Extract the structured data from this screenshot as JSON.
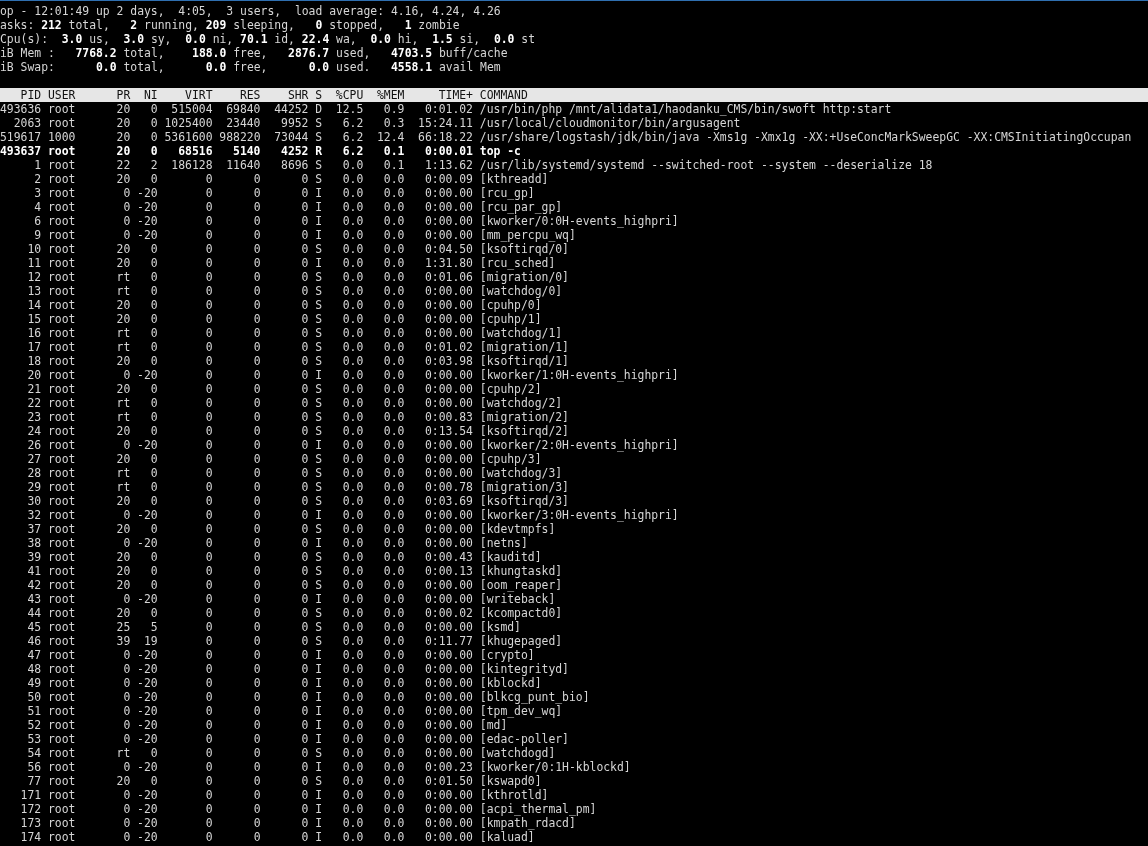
{
  "summary": [
    "op - 12:01:49 up 2 days,  4:05,  3 users,  load average: 4.16, 4.24, 4.26",
    "asks: **212** total,   **2** running, **209** sleeping,   **0** stopped,   **1** zombie",
    "Cpu(s):  **3.0** us,  **3.0** sy,  **0.0** ni, **70.1** id, **22.4** wa,  **0.0** hi,  **1.5** si,  **0.0** st",
    "iB Mem :   **7768.2** total,    **188.0** free,   **2876.7** used,   **4703.5** buff/cache",
    "iB Swap:      **0.0** total,      **0.0** free,      **0.0** used.   **4558.1** avail Mem"
  ],
  "columns": [
    "PID",
    "USER",
    "PR",
    "NI",
    "VIRT",
    "RES",
    "SHR",
    "S",
    "%CPU",
    "%MEM",
    "TIME+",
    "COMMAND"
  ],
  "rows": [
    {
      "bold": false,
      "cells": [
        "493636",
        "root",
        "20",
        "0",
        "515004",
        "69840",
        "44252",
        "D",
        "12.5",
        "0.9",
        "0:01.02",
        "/usr/bin/php /mnt/alidata1/haodanku_CMS/bin/swoft http:start"
      ]
    },
    {
      "bold": false,
      "cells": [
        "2063",
        "root",
        "20",
        "0",
        "1025400",
        "23440",
        "9952",
        "S",
        "6.2",
        "0.3",
        "15:24.11",
        "/usr/local/cloudmonitor/bin/argusagent"
      ]
    },
    {
      "bold": false,
      "cells": [
        "519617",
        "1000",
        "20",
        "0",
        "5361600",
        "988220",
        "73044",
        "S",
        "6.2",
        "12.4",
        "66:18.22",
        "/usr/share/logstash/jdk/bin/java -Xms1g -Xmx1g -XX:+UseConcMarkSweepGC -XX:CMSInitiatingOccupan"
      ]
    },
    {
      "bold": true,
      "cells": [
        "493637",
        "root",
        "20",
        "0",
        "68516",
        "5140",
        "4252",
        "R",
        "6.2",
        "0.1",
        "0:00.01",
        "top -c"
      ]
    },
    {
      "bold": false,
      "cells": [
        "1",
        "root",
        "22",
        "2",
        "186128",
        "11640",
        "8696",
        "S",
        "0.0",
        "0.1",
        "1:13.62",
        "/usr/lib/systemd/systemd --switched-root --system --deserialize 18"
      ]
    },
    {
      "bold": false,
      "cells": [
        "2",
        "root",
        "20",
        "0",
        "0",
        "0",
        "0",
        "S",
        "0.0",
        "0.0",
        "0:00.09",
        "[kthreadd]"
      ]
    },
    {
      "bold": false,
      "cells": [
        "3",
        "root",
        "0",
        "-20",
        "0",
        "0",
        "0",
        "I",
        "0.0",
        "0.0",
        "0:00.00",
        "[rcu_gp]"
      ]
    },
    {
      "bold": false,
      "cells": [
        "4",
        "root",
        "0",
        "-20",
        "0",
        "0",
        "0",
        "I",
        "0.0",
        "0.0",
        "0:00.00",
        "[rcu_par_gp]"
      ]
    },
    {
      "bold": false,
      "cells": [
        "6",
        "root",
        "0",
        "-20",
        "0",
        "0",
        "0",
        "I",
        "0.0",
        "0.0",
        "0:00.00",
        "[kworker/0:0H-events_highpri]"
      ]
    },
    {
      "bold": false,
      "cells": [
        "9",
        "root",
        "0",
        "-20",
        "0",
        "0",
        "0",
        "I",
        "0.0",
        "0.0",
        "0:00.00",
        "[mm_percpu_wq]"
      ]
    },
    {
      "bold": false,
      "cells": [
        "10",
        "root",
        "20",
        "0",
        "0",
        "0",
        "0",
        "S",
        "0.0",
        "0.0",
        "0:04.50",
        "[ksoftirqd/0]"
      ]
    },
    {
      "bold": false,
      "cells": [
        "11",
        "root",
        "20",
        "0",
        "0",
        "0",
        "0",
        "I",
        "0.0",
        "0.0",
        "1:31.80",
        "[rcu_sched]"
      ]
    },
    {
      "bold": false,
      "cells": [
        "12",
        "root",
        "rt",
        "0",
        "0",
        "0",
        "0",
        "S",
        "0.0",
        "0.0",
        "0:01.06",
        "[migration/0]"
      ]
    },
    {
      "bold": false,
      "cells": [
        "13",
        "root",
        "rt",
        "0",
        "0",
        "0",
        "0",
        "S",
        "0.0",
        "0.0",
        "0:00.00",
        "[watchdog/0]"
      ]
    },
    {
      "bold": false,
      "cells": [
        "14",
        "root",
        "20",
        "0",
        "0",
        "0",
        "0",
        "S",
        "0.0",
        "0.0",
        "0:00.00",
        "[cpuhp/0]"
      ]
    },
    {
      "bold": false,
      "cells": [
        "15",
        "root",
        "20",
        "0",
        "0",
        "0",
        "0",
        "S",
        "0.0",
        "0.0",
        "0:00.00",
        "[cpuhp/1]"
      ]
    },
    {
      "bold": false,
      "cells": [
        "16",
        "root",
        "rt",
        "0",
        "0",
        "0",
        "0",
        "S",
        "0.0",
        "0.0",
        "0:00.00",
        "[watchdog/1]"
      ]
    },
    {
      "bold": false,
      "cells": [
        "17",
        "root",
        "rt",
        "0",
        "0",
        "0",
        "0",
        "S",
        "0.0",
        "0.0",
        "0:01.02",
        "[migration/1]"
      ]
    },
    {
      "bold": false,
      "cells": [
        "18",
        "root",
        "20",
        "0",
        "0",
        "0",
        "0",
        "S",
        "0.0",
        "0.0",
        "0:03.98",
        "[ksoftirqd/1]"
      ]
    },
    {
      "bold": false,
      "cells": [
        "20",
        "root",
        "0",
        "-20",
        "0",
        "0",
        "0",
        "I",
        "0.0",
        "0.0",
        "0:00.00",
        "[kworker/1:0H-events_highpri]"
      ]
    },
    {
      "bold": false,
      "cells": [
        "21",
        "root",
        "20",
        "0",
        "0",
        "0",
        "0",
        "S",
        "0.0",
        "0.0",
        "0:00.00",
        "[cpuhp/2]"
      ]
    },
    {
      "bold": false,
      "cells": [
        "22",
        "root",
        "rt",
        "0",
        "0",
        "0",
        "0",
        "S",
        "0.0",
        "0.0",
        "0:00.00",
        "[watchdog/2]"
      ]
    },
    {
      "bold": false,
      "cells": [
        "23",
        "root",
        "rt",
        "0",
        "0",
        "0",
        "0",
        "S",
        "0.0",
        "0.0",
        "0:00.83",
        "[migration/2]"
      ]
    },
    {
      "bold": false,
      "cells": [
        "24",
        "root",
        "20",
        "0",
        "0",
        "0",
        "0",
        "S",
        "0.0",
        "0.0",
        "0:13.54",
        "[ksoftirqd/2]"
      ]
    },
    {
      "bold": false,
      "cells": [
        "26",
        "root",
        "0",
        "-20",
        "0",
        "0",
        "0",
        "I",
        "0.0",
        "0.0",
        "0:00.00",
        "[kworker/2:0H-events_highpri]"
      ]
    },
    {
      "bold": false,
      "cells": [
        "27",
        "root",
        "20",
        "0",
        "0",
        "0",
        "0",
        "S",
        "0.0",
        "0.0",
        "0:00.00",
        "[cpuhp/3]"
      ]
    },
    {
      "bold": false,
      "cells": [
        "28",
        "root",
        "rt",
        "0",
        "0",
        "0",
        "0",
        "S",
        "0.0",
        "0.0",
        "0:00.00",
        "[watchdog/3]"
      ]
    },
    {
      "bold": false,
      "cells": [
        "29",
        "root",
        "rt",
        "0",
        "0",
        "0",
        "0",
        "S",
        "0.0",
        "0.0",
        "0:00.78",
        "[migration/3]"
      ]
    },
    {
      "bold": false,
      "cells": [
        "30",
        "root",
        "20",
        "0",
        "0",
        "0",
        "0",
        "S",
        "0.0",
        "0.0",
        "0:03.69",
        "[ksoftirqd/3]"
      ]
    },
    {
      "bold": false,
      "cells": [
        "32",
        "root",
        "0",
        "-20",
        "0",
        "0",
        "0",
        "I",
        "0.0",
        "0.0",
        "0:00.00",
        "[kworker/3:0H-events_highpri]"
      ]
    },
    {
      "bold": false,
      "cells": [
        "37",
        "root",
        "20",
        "0",
        "0",
        "0",
        "0",
        "S",
        "0.0",
        "0.0",
        "0:00.00",
        "[kdevtmpfs]"
      ]
    },
    {
      "bold": false,
      "cells": [
        "38",
        "root",
        "0",
        "-20",
        "0",
        "0",
        "0",
        "I",
        "0.0",
        "0.0",
        "0:00.00",
        "[netns]"
      ]
    },
    {
      "bold": false,
      "cells": [
        "39",
        "root",
        "20",
        "0",
        "0",
        "0",
        "0",
        "S",
        "0.0",
        "0.0",
        "0:00.43",
        "[kauditd]"
      ]
    },
    {
      "bold": false,
      "cells": [
        "41",
        "root",
        "20",
        "0",
        "0",
        "0",
        "0",
        "S",
        "0.0",
        "0.0",
        "0:00.13",
        "[khungtaskd]"
      ]
    },
    {
      "bold": false,
      "cells": [
        "42",
        "root",
        "20",
        "0",
        "0",
        "0",
        "0",
        "S",
        "0.0",
        "0.0",
        "0:00.00",
        "[oom_reaper]"
      ]
    },
    {
      "bold": false,
      "cells": [
        "43",
        "root",
        "0",
        "-20",
        "0",
        "0",
        "0",
        "I",
        "0.0",
        "0.0",
        "0:00.00",
        "[writeback]"
      ]
    },
    {
      "bold": false,
      "cells": [
        "44",
        "root",
        "20",
        "0",
        "0",
        "0",
        "0",
        "S",
        "0.0",
        "0.0",
        "0:00.02",
        "[kcompactd0]"
      ]
    },
    {
      "bold": false,
      "cells": [
        "45",
        "root",
        "25",
        "5",
        "0",
        "0",
        "0",
        "S",
        "0.0",
        "0.0",
        "0:00.00",
        "[ksmd]"
      ]
    },
    {
      "bold": false,
      "cells": [
        "46",
        "root",
        "39",
        "19",
        "0",
        "0",
        "0",
        "S",
        "0.0",
        "0.0",
        "0:11.77",
        "[khugepaged]"
      ]
    },
    {
      "bold": false,
      "cells": [
        "47",
        "root",
        "0",
        "-20",
        "0",
        "0",
        "0",
        "I",
        "0.0",
        "0.0",
        "0:00.00",
        "[crypto]"
      ]
    },
    {
      "bold": false,
      "cells": [
        "48",
        "root",
        "0",
        "-20",
        "0",
        "0",
        "0",
        "I",
        "0.0",
        "0.0",
        "0:00.00",
        "[kintegrityd]"
      ]
    },
    {
      "bold": false,
      "cells": [
        "49",
        "root",
        "0",
        "-20",
        "0",
        "0",
        "0",
        "I",
        "0.0",
        "0.0",
        "0:00.00",
        "[kblockd]"
      ]
    },
    {
      "bold": false,
      "cells": [
        "50",
        "root",
        "0",
        "-20",
        "0",
        "0",
        "0",
        "I",
        "0.0",
        "0.0",
        "0:00.00",
        "[blkcg_punt_bio]"
      ]
    },
    {
      "bold": false,
      "cells": [
        "51",
        "root",
        "0",
        "-20",
        "0",
        "0",
        "0",
        "I",
        "0.0",
        "0.0",
        "0:00.00",
        "[tpm_dev_wq]"
      ]
    },
    {
      "bold": false,
      "cells": [
        "52",
        "root",
        "0",
        "-20",
        "0",
        "0",
        "0",
        "I",
        "0.0",
        "0.0",
        "0:00.00",
        "[md]"
      ]
    },
    {
      "bold": false,
      "cells": [
        "53",
        "root",
        "0",
        "-20",
        "0",
        "0",
        "0",
        "I",
        "0.0",
        "0.0",
        "0:00.00",
        "[edac-poller]"
      ]
    },
    {
      "bold": false,
      "cells": [
        "54",
        "root",
        "rt",
        "0",
        "0",
        "0",
        "0",
        "S",
        "0.0",
        "0.0",
        "0:00.00",
        "[watchdogd]"
      ]
    },
    {
      "bold": false,
      "cells": [
        "56",
        "root",
        "0",
        "-20",
        "0",
        "0",
        "0",
        "I",
        "0.0",
        "0.0",
        "0:00.23",
        "[kworker/0:1H-kblockd]"
      ]
    },
    {
      "bold": false,
      "cells": [
        "77",
        "root",
        "20",
        "0",
        "0",
        "0",
        "0",
        "S",
        "0.0",
        "0.0",
        "0:01.50",
        "[kswapd0]"
      ]
    },
    {
      "bold": false,
      "cells": [
        "171",
        "root",
        "0",
        "-20",
        "0",
        "0",
        "0",
        "I",
        "0.0",
        "0.0",
        "0:00.00",
        "[kthrotld]"
      ]
    },
    {
      "bold": false,
      "cells": [
        "172",
        "root",
        "0",
        "-20",
        "0",
        "0",
        "0",
        "I",
        "0.0",
        "0.0",
        "0:00.00",
        "[acpi_thermal_pm]"
      ]
    },
    {
      "bold": false,
      "cells": [
        "173",
        "root",
        "0",
        "-20",
        "0",
        "0",
        "0",
        "I",
        "0.0",
        "0.0",
        "0:00.00",
        "[kmpath_rdacd]"
      ]
    },
    {
      "bold": false,
      "cells": [
        "174",
        "root",
        "0",
        "-20",
        "0",
        "0",
        "0",
        "I",
        "0.0",
        "0.0",
        "0:00.00",
        "[kaluad]"
      ]
    }
  ]
}
